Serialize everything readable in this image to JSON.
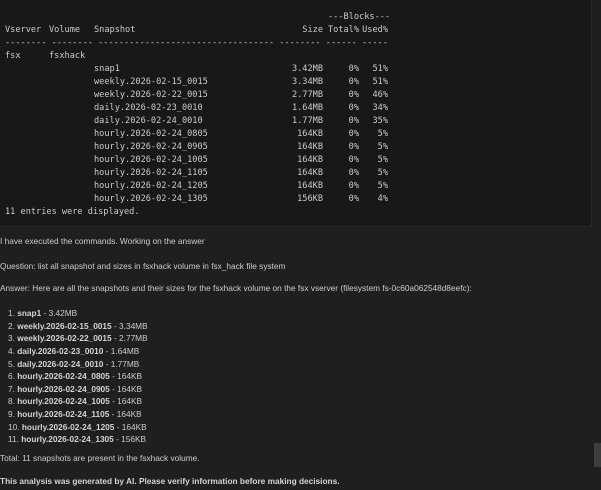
{
  "terminal": {
    "blocks_header": "---Blocks---",
    "headers": {
      "vserver": "Vserver",
      "volume": "Volume",
      "snapshot": "Snapshot",
      "size": "Size",
      "total": "Total%",
      "used": "Used%"
    },
    "separator": "-------- -------- ---------------------------------- -------- ------ -----",
    "vserver": "fsx",
    "volume": "fsxhack",
    "rows": [
      {
        "name": "snap1",
        "size": "3.42MB",
        "total": "0%",
        "used": "51%"
      },
      {
        "name": "weekly.2026-02-15_0015",
        "size": "3.34MB",
        "total": "0%",
        "used": "51%"
      },
      {
        "name": "weekly.2026-02-22_0015",
        "size": "2.77MB",
        "total": "0%",
        "used": "46%"
      },
      {
        "name": "daily.2026-02-23_0010",
        "size": "1.64MB",
        "total": "0%",
        "used": "34%"
      },
      {
        "name": "daily.2026-02-24_0010",
        "size": "1.77MB",
        "total": "0%",
        "used": "35%"
      },
      {
        "name": "hourly.2026-02-24_0805",
        "size": "164KB",
        "total": "0%",
        "used": "5%"
      },
      {
        "name": "hourly.2026-02-24_0905",
        "size": "164KB",
        "total": "0%",
        "used": "5%"
      },
      {
        "name": "hourly.2026-02-24_1005",
        "size": "164KB",
        "total": "0%",
        "used": "5%"
      },
      {
        "name": "hourly.2026-02-24_1105",
        "size": "164KB",
        "total": "0%",
        "used": "5%"
      },
      {
        "name": "hourly.2026-02-24_1205",
        "size": "164KB",
        "total": "0%",
        "used": "5%"
      },
      {
        "name": "hourly.2026-02-24_1305",
        "size": "156KB",
        "total": "0%",
        "used": "4%"
      }
    ],
    "footer": "11 entries were displayed."
  },
  "chat": {
    "status": "I have executed the commands. Working on the answer",
    "question": "Question: list all snapshot and sizes in fsxhack volume in fsx_hack file system",
    "answer_intro": "Answer: Here are all the snapshots and their sizes for the fsxhack volume on the fsx vserver (filesystem fs-0c60a062548d8eefc):",
    "items": [
      {
        "num": "1.",
        "name": "snap1",
        "size": "- 3.42MB"
      },
      {
        "num": "2.",
        "name": "weekly.2026-02-15_0015",
        "size": "- 3.34MB"
      },
      {
        "num": "3.",
        "name": "weekly.2026-02-22_0015",
        "size": "- 2.77MB"
      },
      {
        "num": "4.",
        "name": "daily.2026-02-23_0010",
        "size": "- 1.64MB"
      },
      {
        "num": "5.",
        "name": "daily.2026-02-24_0010",
        "size": "- 1.77MB"
      },
      {
        "num": "6.",
        "name": "hourly.2026-02-24_0805",
        "size": "- 164KB"
      },
      {
        "num": "7.",
        "name": "hourly.2026-02-24_0905",
        "size": "- 164KB"
      },
      {
        "num": "8.",
        "name": "hourly.2026-02-24_1005",
        "size": "- 164KB"
      },
      {
        "num": "9.",
        "name": "hourly.2026-02-24_1105",
        "size": "- 164KB"
      },
      {
        "num": "10.",
        "name": "hourly.2026-02-24_1205",
        "size": "- 164KB"
      },
      {
        "num": "11.",
        "name": "hourly.2026-02-24_1305",
        "size": "- 156KB"
      }
    ],
    "total": "Total: 11 snapshots are present in the fsxhack volume.",
    "disclaimer": "This analysis was generated by AI. Please verify information before making decisions."
  }
}
